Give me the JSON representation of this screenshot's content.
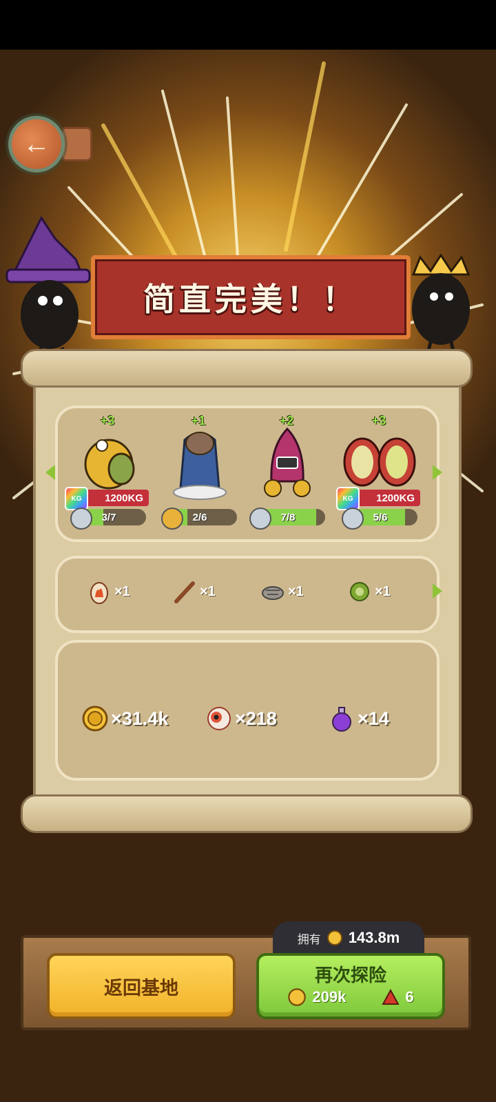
{
  "banner": {
    "title": "简直完美！！"
  },
  "creatures": [
    {
      "bonus": "+3",
      "weight": "1200KG",
      "weight_icon_text": "KG",
      "progress_text": "3/7",
      "progress": 0.43,
      "color": "#e7b531"
    },
    {
      "bonus": "+1",
      "weight": "",
      "weight_icon_text": "",
      "progress_text": "2/6",
      "progress": 0.33,
      "color": "#3d5f9d"
    },
    {
      "bonus": "+2",
      "weight": "",
      "weight_icon_text": "",
      "progress_text": "7/8",
      "progress": 0.88,
      "color": "#b4346c"
    },
    {
      "bonus": "+3",
      "weight": "1200KG",
      "weight_icon_text": "KG",
      "progress_text": "5/6",
      "progress": 0.83,
      "color": "#c64236"
    }
  ],
  "items": [
    {
      "icon": "fire-egg-icon",
      "count": "×1"
    },
    {
      "icon": "wood-stick-icon",
      "count": "×1"
    },
    {
      "icon": "fossil-icon",
      "count": "×1"
    },
    {
      "icon": "green-seed-icon",
      "count": "×1"
    }
  ],
  "resources": [
    {
      "icon": "gold-coin-icon",
      "count": "×31.4k"
    },
    {
      "icon": "eyeball-icon",
      "count": "×218"
    },
    {
      "icon": "purple-potion-icon",
      "count": "×14"
    }
  ],
  "owned": {
    "label": "拥有",
    "value": "143.8m"
  },
  "buttons": {
    "return_label": "返回基地",
    "again_label": "再次探险",
    "again_coin_cost": "209k",
    "again_gem_cost": "6"
  },
  "colors": {
    "accent_green": "#8ad24a",
    "banner_red": "#a8332b",
    "button_yellow": "#f2b228"
  }
}
